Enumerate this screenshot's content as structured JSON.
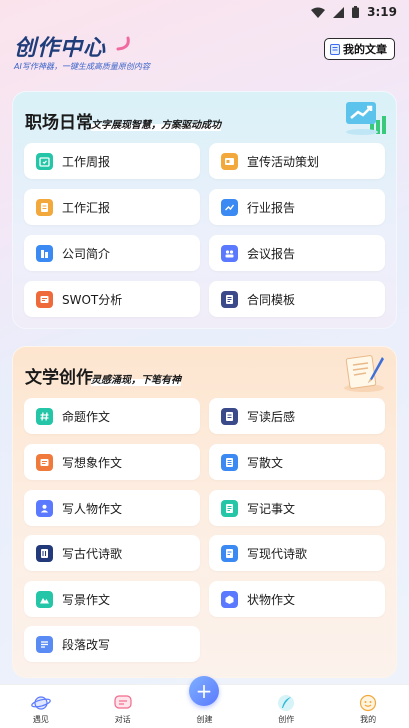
{
  "status_bar": {
    "time": "3:19"
  },
  "header": {
    "title": "创作中心",
    "subtitle": "AI写作神器，一键生成高质量原创内容",
    "my_articles_label": "我的文章"
  },
  "work_section": {
    "title": "职场日常",
    "tagline": "文字展现智慧，方案驱动成功",
    "items": [
      {
        "label": "工作周报",
        "icon": "calendar-icon",
        "color": "#25c6a8"
      },
      {
        "label": "宣传活动策划",
        "icon": "campaign-icon",
        "color": "#f3a83b"
      },
      {
        "label": "工作汇报",
        "icon": "report-icon",
        "color": "#f3a83b"
      },
      {
        "label": "行业报告",
        "icon": "chart-icon",
        "color": "#3b8af3"
      },
      {
        "label": "公司简介",
        "icon": "building-icon",
        "color": "#3b8af3"
      },
      {
        "label": "会议报告",
        "icon": "meeting-icon",
        "color": "#5a79ff"
      },
      {
        "label": "SWOT分析",
        "icon": "swot-icon",
        "color": "#ef6a3a"
      },
      {
        "label": "合同模板",
        "icon": "contract-icon",
        "color": "#3a4a8a"
      }
    ]
  },
  "literature_section": {
    "title": "文学创作",
    "tagline": "灵感涌现，下笔有神",
    "items": [
      {
        "label": "命题作文",
        "icon": "hash-icon",
        "color": "#25c6a8"
      },
      {
        "label": "写读后感",
        "icon": "book-note-icon",
        "color": "#3a4a8a"
      },
      {
        "label": "写想象作文",
        "icon": "imagine-icon",
        "color": "#f07a3c"
      },
      {
        "label": "写散文",
        "icon": "document-icon",
        "color": "#3b8af3"
      },
      {
        "label": "写人物作文",
        "icon": "people-icon",
        "color": "#5a79ff"
      },
      {
        "label": "写记事文",
        "icon": "notes-icon",
        "color": "#25c6a8"
      },
      {
        "label": "写古代诗歌",
        "icon": "scroll-icon",
        "color": "#233a7a"
      },
      {
        "label": "写现代诗歌",
        "icon": "pen-doc-icon",
        "color": "#3b8af3"
      },
      {
        "label": "写景作文",
        "icon": "landscape-icon",
        "color": "#25c6a8"
      },
      {
        "label": "状物作文",
        "icon": "object-icon",
        "color": "#5a79ff"
      },
      {
        "label": "段落改写",
        "icon": "rewrite-icon",
        "color": "#5a8af3"
      }
    ]
  },
  "bottom_nav": {
    "items": [
      {
        "label": "遇见",
        "icon": "planet-icon"
      },
      {
        "label": "对话",
        "icon": "chat-icon"
      },
      {
        "label": "创建",
        "icon": "plus-icon"
      },
      {
        "label": "创作",
        "icon": "quill-icon"
      },
      {
        "label": "我的",
        "icon": "profile-icon"
      }
    ]
  },
  "colors": {
    "title_blue": "#1f3d7a",
    "subtitle_blue": "#3a63c9",
    "work_card_bg": "#d9f1f7",
    "lit_card_bg": "#fde5cf",
    "fab_blue": "#5a79ff"
  }
}
